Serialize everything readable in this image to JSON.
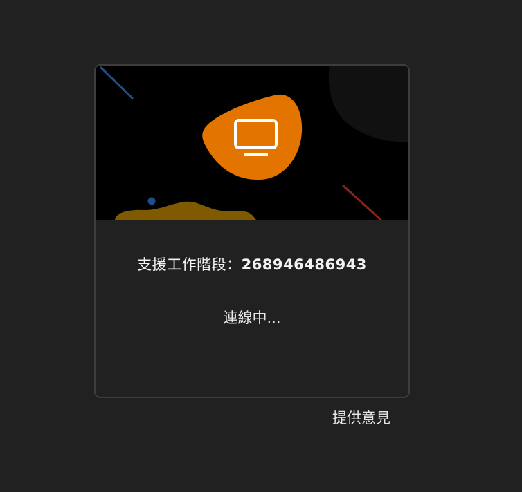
{
  "session": {
    "label": "支援工作階段：",
    "number": "268946486943"
  },
  "status": {
    "text": "連線中..."
  },
  "footer": {
    "feedback_label": "提供意見"
  },
  "banner": {
    "icon": "monitor-icon",
    "colors": {
      "background": "#000000",
      "blob_accent": "#e37400",
      "wave": "#7f5a00",
      "dark_corner": "#111111",
      "blue_line": "#1f4e8c",
      "red_line": "#8b2416",
      "dot": "#1f4e8c"
    }
  },
  "colors": {
    "page_background": "#212121",
    "card_border": "#3d3d3d",
    "text": "#f2f2f2"
  }
}
